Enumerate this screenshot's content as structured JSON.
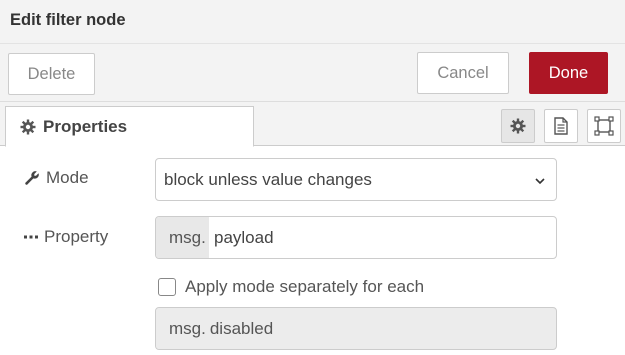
{
  "dialog": {
    "title": "Edit filter node"
  },
  "buttons": {
    "delete": "Delete",
    "cancel": "Cancel",
    "done": "Done"
  },
  "tabs": {
    "properties_label": "Properties"
  },
  "form": {
    "mode": {
      "label": "Mode",
      "selected": "block unless value changes"
    },
    "property": {
      "label": "Property",
      "prefix": "msg.",
      "value": "payload"
    },
    "apply_separately": {
      "label": "Apply mode separately for each",
      "checked": false
    },
    "disabled_input": {
      "prefix": "msg.",
      "value": "disabled"
    }
  },
  "colors": {
    "done_button": "#ad1625",
    "header_bg": "#f3f3f3"
  },
  "icons": {
    "tab": "gear-icon",
    "mode": "wrench-icon",
    "property": "ellipsis-icon",
    "settings_tab": "gear-icon",
    "description_tab": "document-icon",
    "appearance_tab": "frame-icon"
  }
}
